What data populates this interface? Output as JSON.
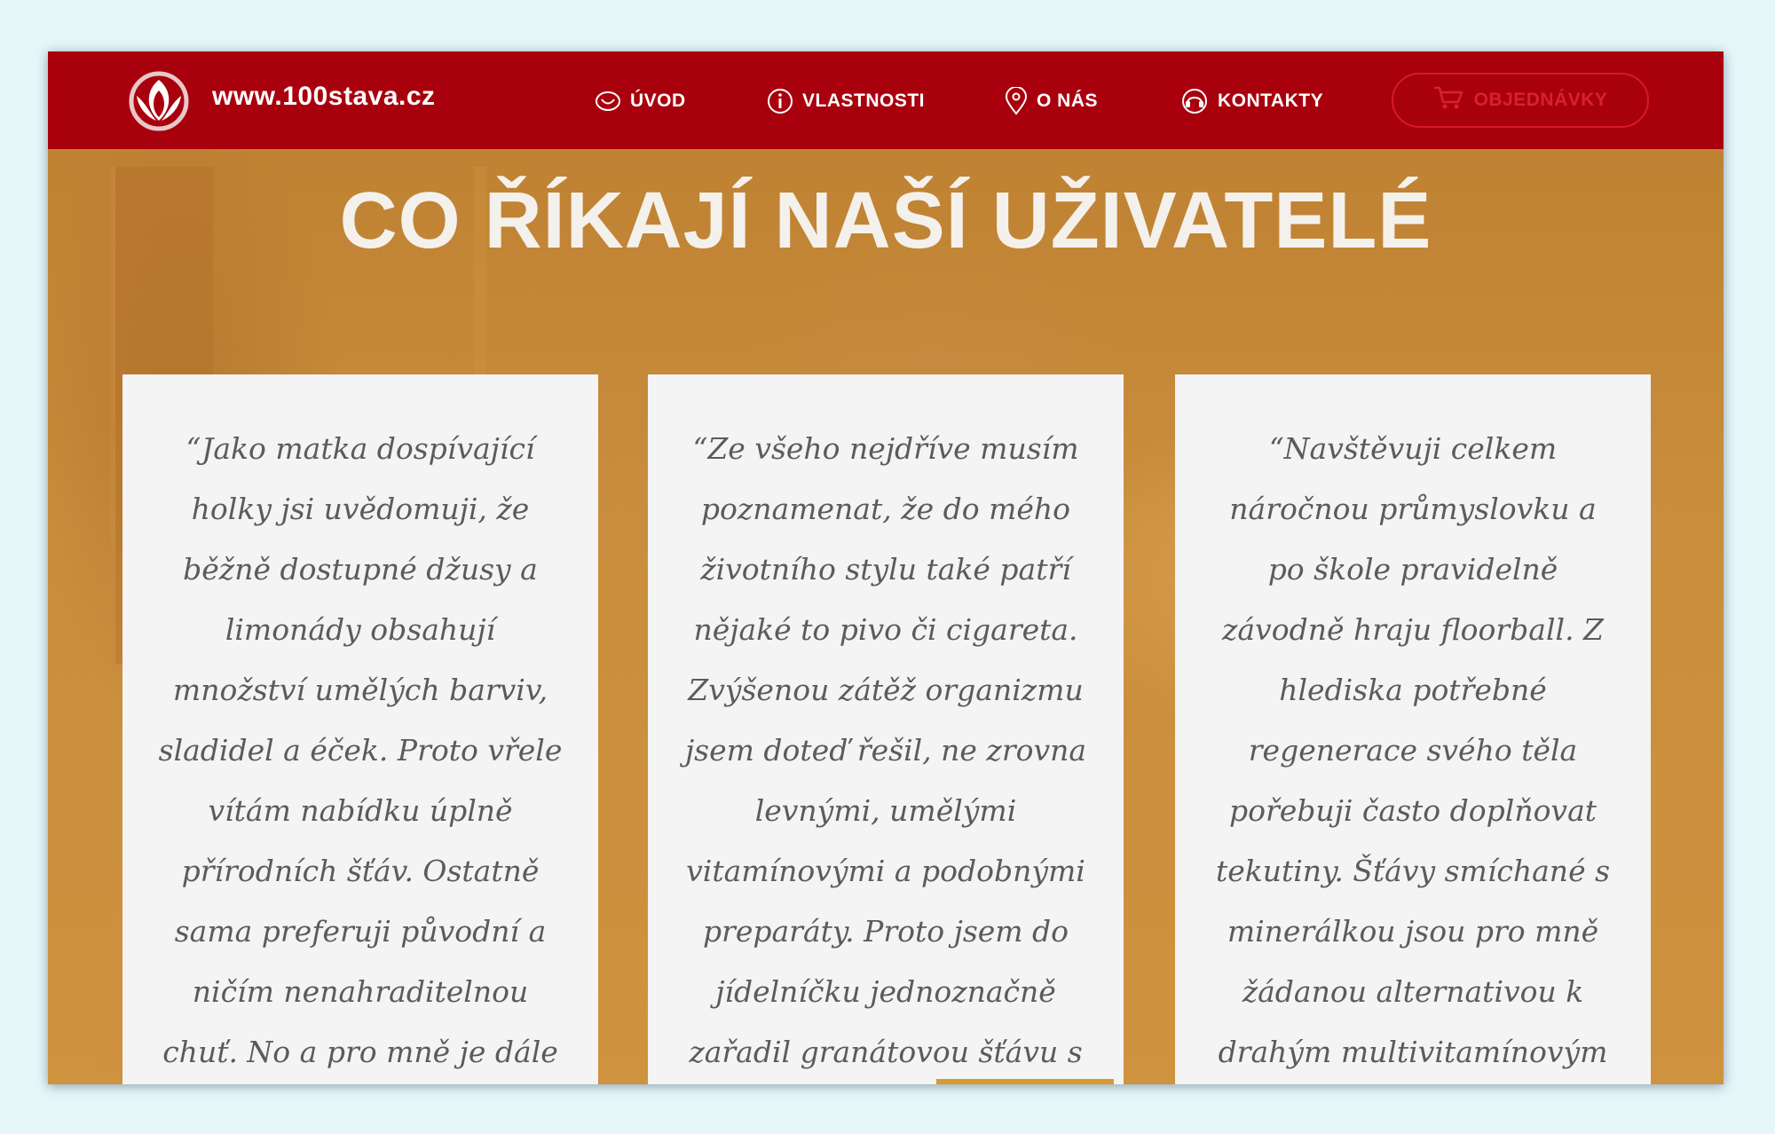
{
  "brand": {
    "text": "www.100stava.cz"
  },
  "nav": {
    "items": [
      {
        "label": "ÚVOD",
        "icon": "smile-icon"
      },
      {
        "label": "VLASTNOSTI",
        "icon": "info-icon"
      },
      {
        "label": "O NÁS",
        "icon": "location-pin-icon"
      },
      {
        "label": "KONTAKTY",
        "icon": "phone-headset-icon"
      }
    ],
    "order_button": {
      "label": "OBJEDNÁVKY",
      "icon": "cart-icon"
    }
  },
  "section": {
    "title": "CO ŘÍKAJÍ NAŠÍ UŽIVATELÉ"
  },
  "testimonials": [
    {
      "lines": [
        "“Jako matka dospívající",
        "holky jsi uvědomuji, že",
        "běžně dostupné džusy a",
        "limonády obsahují",
        "množství umělých barviv,",
        "sladidel a éček. Proto vřele",
        "vítám nabídku úplně",
        "přírodních šťáv. Ostatně",
        "sama preferuji původní a",
        "ničím nenahraditelnou",
        "chuť. No a pro mně je dále"
      ]
    },
    {
      "lines": [
        "“Ze všeho nejdříve musím",
        "poznamenat, že do mého",
        "životního stylu také patří",
        "nějaké to pivo či cigareta.",
        "Zvýšenou zátěž organizmu",
        "jsem doteď řešil, ne zrovna",
        "levnými, umělými",
        "vitamínovými a podobnými",
        "preparáty. Proto jsem do",
        "jídelníčku jednoznačně",
        "zařadil granátovou šťávu s"
      ]
    },
    {
      "lines": [
        "“Navštěvuji celkem",
        "náročnou průmyslovku a",
        "po škole pravidelně",
        "závodně hraju floorball. Z",
        "hlediska potřebné",
        "regenerace svého těla",
        "pořebuji často doplňovat",
        "tekutiny. Šťávy smíchané s",
        "minerálkou jsou pro mně",
        "žádanou alternativou k",
        "drahým multivitamínovým"
      ]
    }
  ],
  "colors": {
    "navbar": "#a9000d",
    "accent": "#d8212f",
    "hero_overlay": "#c58a35",
    "card": "#f4f4f4",
    "quote_text": "#5b5b5b"
  }
}
